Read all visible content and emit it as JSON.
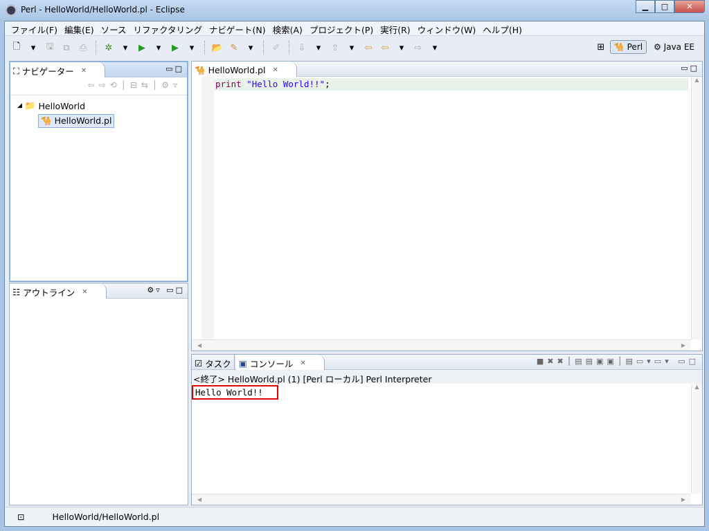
{
  "window": {
    "title": "Perl - HelloWorld/HelloWorld.pl - Eclipse",
    "minimize": "▁",
    "maximize": "□",
    "close": "✕"
  },
  "menu": [
    "ファイル(F)",
    "編集(E)",
    "ソース",
    "リファクタリング",
    "ナビゲート(N)",
    "検索(A)",
    "プロジェクト(P)",
    "実行(R)",
    "ウィンドウ(W)",
    "ヘルプ(H)"
  ],
  "perspectives": {
    "perl": "Perl",
    "javaee": "Java EE"
  },
  "navigator": {
    "title": "ナビゲーター",
    "project": "HelloWorld",
    "file": "HelloWorld.pl"
  },
  "outline": {
    "title": "アウトライン"
  },
  "editor": {
    "tab": "HelloWorld.pl",
    "keyword": "print",
    "string": "\"Hello World!!\"",
    "end": ";"
  },
  "console": {
    "tab_tasks": "タスク",
    "tab_console": "コンソール",
    "header": "<終了> HelloWorld.pl (1) [Perl ローカル] Perl Interpreter",
    "output": "Hello World!!"
  },
  "status": {
    "path": "HelloWorld/HelloWorld.pl"
  },
  "colors": {
    "keyword": "#7f0055",
    "string": "#2a00ff",
    "highlight": "#e00000",
    "current_line": "#e8f2e8"
  }
}
